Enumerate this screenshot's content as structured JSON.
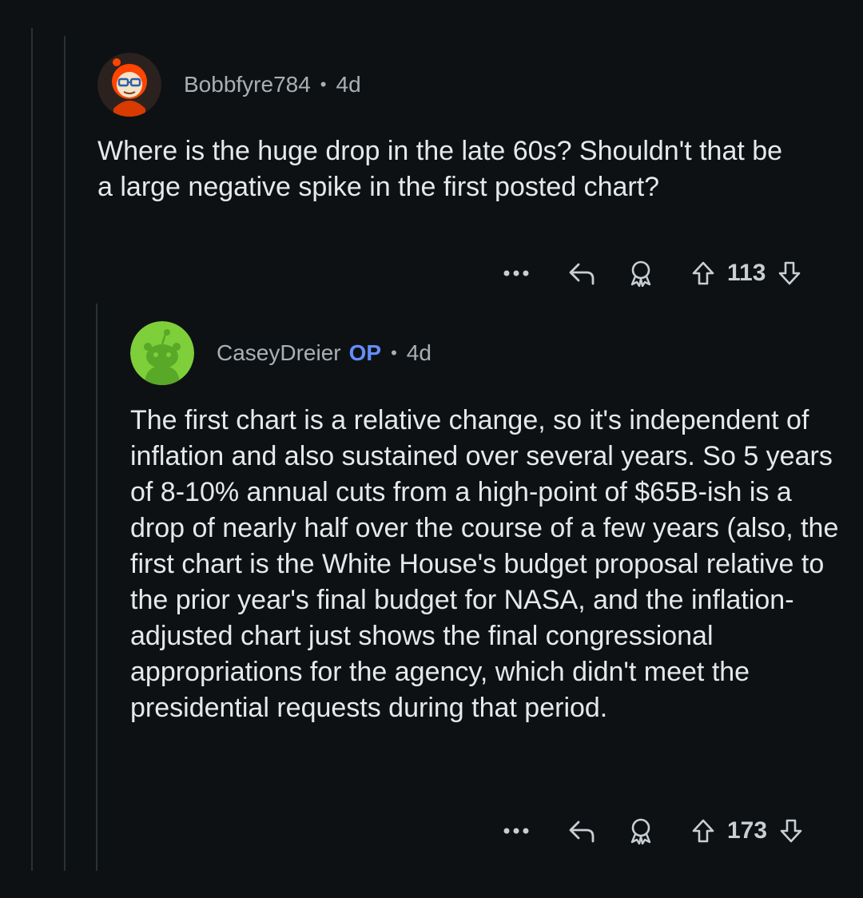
{
  "comments": [
    {
      "username": "Bobbfyre784",
      "is_op": false,
      "age": "4d",
      "body": "Where is the huge drop in the late 60s? Shouldn't that be a large negative spike in the first posted chart?",
      "votes": "113",
      "avatar_icon": "snoo-avatar-glasses",
      "accent_color": "#ff4500"
    },
    {
      "username": "CaseyDreier",
      "is_op": true,
      "op_label": "OP",
      "age": "4d",
      "body": "The first chart is a relative change, so it's independent of inflation and also sustained over several years. So 5 years of 8-10% annual cuts from a high-point of $65B-ish is a drop of nearly half over the course of a few years (also, the first chart is the White House's budget proposal relative to the prior year's final budget for NASA, and the inflation-adjusted chart just shows the final congressional appropriations for the agency, which didn't meet the presidential requests during that period.",
      "votes": "173",
      "avatar_icon": "snoo-avatar-default",
      "accent_color": "#7ecf3a"
    }
  ],
  "meta_separator": "•",
  "colors": {
    "background": "#0e1113",
    "text": "#e6e8ea",
    "meta": "#a8b0b6",
    "op_badge": "#648efc",
    "thread_line": "#2a3136"
  }
}
